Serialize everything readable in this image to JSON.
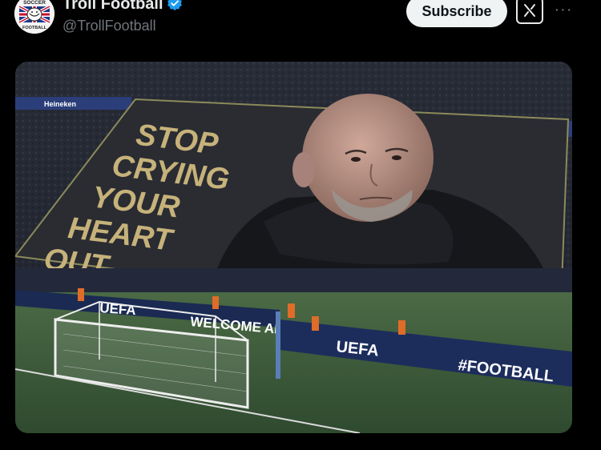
{
  "author": {
    "name": "Troll Football",
    "handle": "@TrollFootball",
    "verified": true,
    "avatar_text_top": "SOCCER",
    "avatar_text_bottom": "FOOTBALL"
  },
  "actions": {
    "subscribe_label": "Subscribe",
    "grok_icon": "grok-icon",
    "more_icon": "more-icon"
  },
  "media": {
    "banner_lines": [
      "STOP",
      "CRYING",
      "YOUR",
      "HEART",
      "OUT"
    ],
    "ad_boards": [
      "UEFA",
      "WELCOME ALL",
      "UEFA",
      "#FOOTBALL"
    ],
    "sponsor": "Heineken"
  },
  "colors": {
    "accent_blue": "#1d9bf0",
    "banner_gold": "#c6b27a",
    "pitch_green": "#3f5a3a"
  }
}
